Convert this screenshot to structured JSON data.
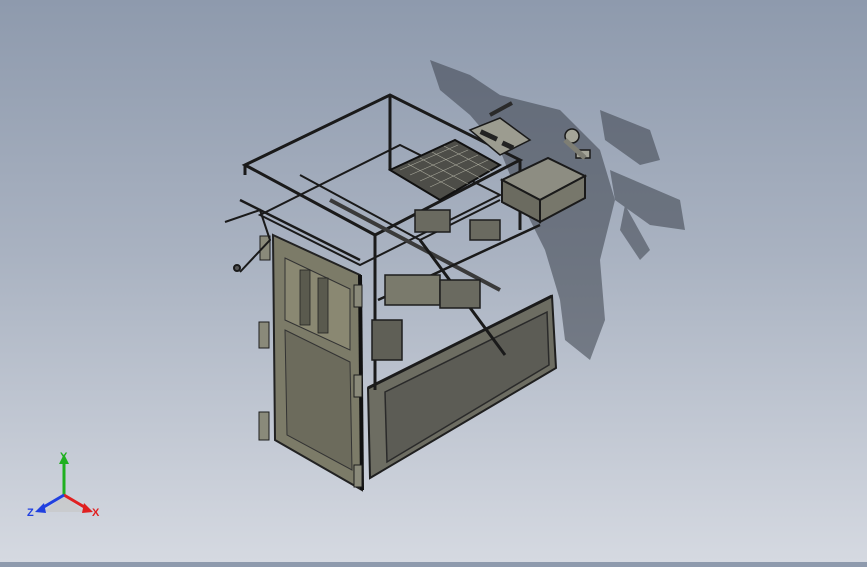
{
  "viewport": {
    "background_top": "#8e9aad",
    "background_bottom": "#d5d9e1",
    "model_color": "#6f6e60",
    "frame_color": "#2b2b2b",
    "shadow_color": "#3a3f47"
  },
  "triad": {
    "x_label": "X",
    "y_label": "Y",
    "z_label": "Z",
    "x_color": "#e02020",
    "y_color": "#20b020",
    "z_color": "#2040e0"
  }
}
